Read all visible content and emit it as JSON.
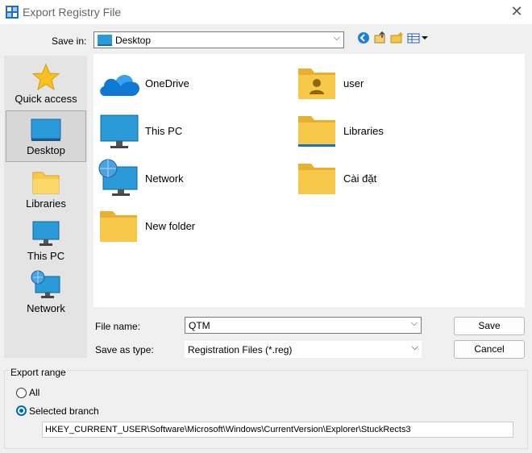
{
  "window": {
    "title": "Export Registry File"
  },
  "save_in": {
    "label": "Save in:",
    "value": "Desktop"
  },
  "toolbar": {
    "icons": [
      "back-icon",
      "up-folder-icon",
      "new-folder-icon",
      "view-menu-icon"
    ]
  },
  "places": [
    {
      "label": "Quick access",
      "icon": "star-icon"
    },
    {
      "label": "Desktop",
      "icon": "desktop-icon",
      "selected": true
    },
    {
      "label": "Libraries",
      "icon": "folder-icon"
    },
    {
      "label": "This PC",
      "icon": "monitor-icon"
    },
    {
      "label": "Network",
      "icon": "network-icon"
    }
  ],
  "files": [
    {
      "label": "OneDrive",
      "icon": "onedrive-icon"
    },
    {
      "label": "user",
      "icon": "user-folder-icon"
    },
    {
      "label": "This PC",
      "icon": "monitor-icon"
    },
    {
      "label": "Libraries",
      "icon": "folder-icon"
    },
    {
      "label": "Network",
      "icon": "network-icon"
    },
    {
      "label": "Cài đặt",
      "icon": "folder-icon"
    },
    {
      "label": "New folder",
      "icon": "folder-icon"
    }
  ],
  "file_name": {
    "label": "File name:",
    "value": "QTM"
  },
  "save_type": {
    "label": "Save as type:",
    "value": "Registration Files (*.reg)"
  },
  "buttons": {
    "save": "Save",
    "cancel": "Cancel"
  },
  "export_range": {
    "title": "Export range",
    "all_label": "All",
    "selected_label": "Selected branch",
    "selected": "branch",
    "branch_path": "HKEY_CURRENT_USER\\Software\\Microsoft\\Windows\\CurrentVersion\\Explorer\\StuckRects3"
  },
  "colors": {
    "accent": "#0067c0",
    "folder": "#f8c848",
    "monitor": "#2a9bd8"
  }
}
